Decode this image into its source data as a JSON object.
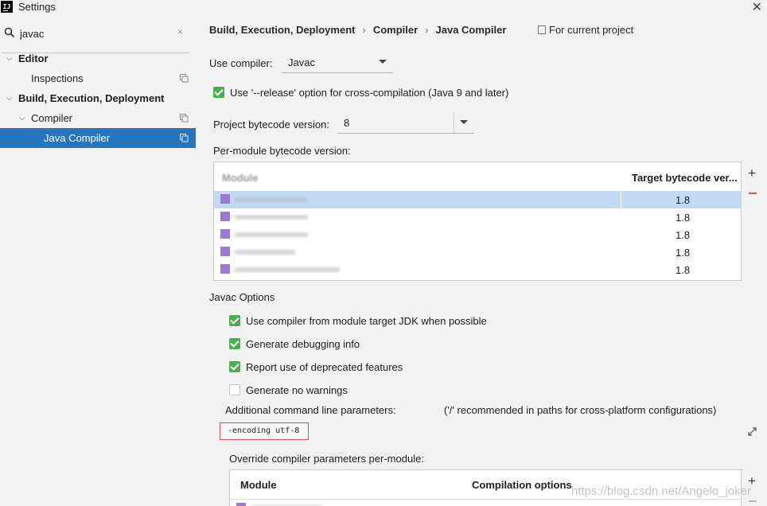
{
  "window": {
    "title": "Settings",
    "app_icon": "IJ",
    "close_icon": "close-icon"
  },
  "sidebar": {
    "search": {
      "value": "javac",
      "placeholder": "",
      "clear_symbol": "×"
    },
    "items": [
      {
        "label": "Editor",
        "expanded": true,
        "level": 0,
        "bold": true
      },
      {
        "label": "Inspections",
        "level": 1,
        "copy_icon": true
      },
      {
        "label": "Build, Execution, Deployment",
        "expanded": true,
        "level": 0,
        "bold": true
      },
      {
        "label": "Compiler",
        "expanded": true,
        "level": 1,
        "copy_icon": true
      },
      {
        "label": "Java Compiler",
        "level": 2,
        "selected": true,
        "copy_icon": true
      }
    ]
  },
  "main": {
    "breadcrumb": [
      "Build, Execution, Deployment",
      "Compiler",
      "Java Compiler"
    ],
    "breadcrumb_sep": "›",
    "for_project": "For current project",
    "use_compiler_label": "Use compiler:",
    "use_compiler_value": "Javac",
    "release_option": {
      "label": "Use '--release' option for cross-compilation (Java 9 and later)",
      "checked": true
    },
    "project_bytecode_label": "Project bytecode version:",
    "project_bytecode_value": "8",
    "per_module_label": "Per-module bytecode version:",
    "module_table": {
      "headers": [
        "Module",
        "Target bytecode ver..."
      ],
      "rows": [
        {
          "module": "",
          "target": "1.8",
          "selected": true
        },
        {
          "module": "",
          "target": "1.8"
        },
        {
          "module": "",
          "target": "1.8"
        },
        {
          "module": "",
          "target": "1.8"
        },
        {
          "module": "",
          "target": "1.8"
        }
      ],
      "add_symbol": "+",
      "remove_symbol": "−"
    },
    "javac_options_label": "Javac Options",
    "options": [
      {
        "label": "Use compiler from module target JDK when possible",
        "checked": true
      },
      {
        "label": "Generate debugging info",
        "checked": true
      },
      {
        "label": "Report use of deprecated features",
        "checked": true
      },
      {
        "label": "Generate no warnings",
        "checked": false
      }
    ],
    "additional_params_label": "Additional command line parameters:",
    "additional_params_hint": "('/' recommended in paths for cross-platform configurations)",
    "additional_params_value": "-encoding utf-8",
    "override_label": "Override compiler parameters per-module:",
    "override_table": {
      "headers": [
        "Module",
        "Compilation options"
      ],
      "add_symbol": "+"
    },
    "watermark": "https://blog.csdn.net/Angelo_joker"
  },
  "colors": {
    "selection": "#2675bf",
    "row_selection": "#c2daf4",
    "checkbox": "#4bae4f",
    "highlight_border": "#d9534f"
  }
}
